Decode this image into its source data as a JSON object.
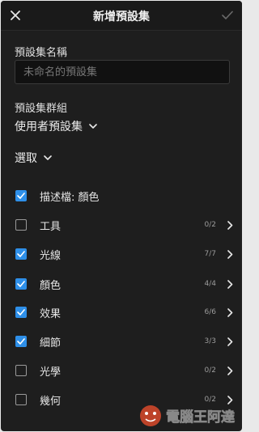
{
  "header": {
    "title": "新增預設集"
  },
  "name_section": {
    "label": "預設集名稱",
    "placeholder": "未命名的預設集"
  },
  "group_section": {
    "label": "預設集群組",
    "selected": "使用者預設集"
  },
  "select_dropdown": {
    "label": "選取"
  },
  "items": [
    {
      "label": "描述檔: 顏色",
      "checked": true,
      "count": ""
    },
    {
      "label": "工具",
      "checked": false,
      "count": "0/2"
    },
    {
      "label": "光線",
      "checked": true,
      "count": "7/7"
    },
    {
      "label": "顏色",
      "checked": true,
      "count": "4/4"
    },
    {
      "label": "效果",
      "checked": true,
      "count": "6/6"
    },
    {
      "label": "細節",
      "checked": true,
      "count": "3/3"
    },
    {
      "label": "光學",
      "checked": false,
      "count": "0/2"
    },
    {
      "label": "幾何",
      "checked": false,
      "count": "0/2"
    }
  ],
  "watermark": {
    "text": "電腦王阿達"
  },
  "colors": {
    "background": "#1e1e1e",
    "checkbox_on": "#2e8fe8",
    "text": "#e6e6e6",
    "muted": "#9c9c9c"
  }
}
